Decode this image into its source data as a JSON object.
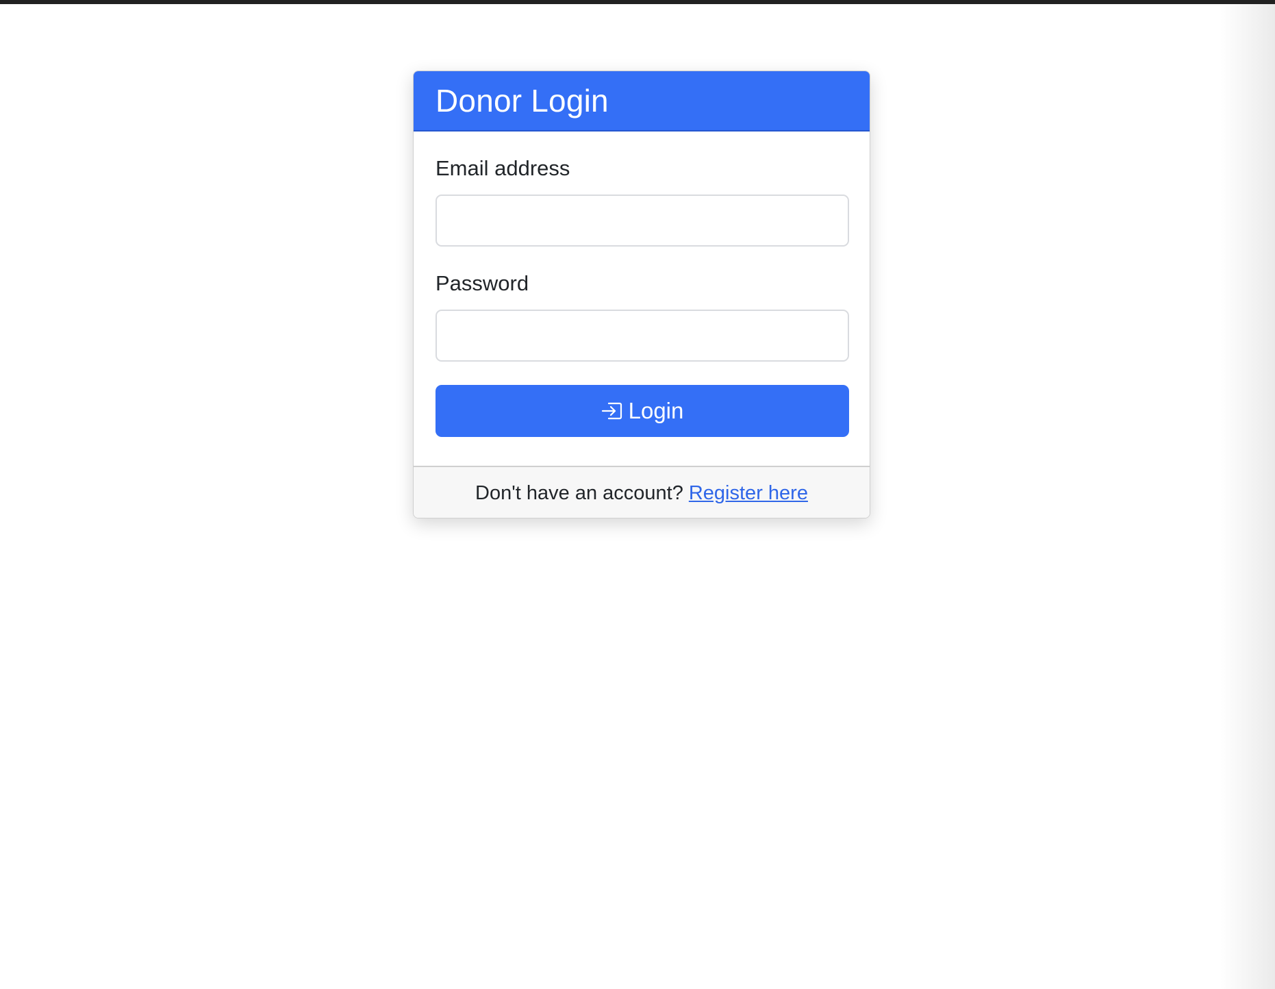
{
  "page": {
    "colors": {
      "primary": "#346ff6",
      "link": "#2f66e8",
      "top_bar": "#212121",
      "footer_bg": "#f7f7f7"
    }
  },
  "card": {
    "title": "Donor Login",
    "email": {
      "label": "Email address",
      "value": "",
      "placeholder": ""
    },
    "password": {
      "label": "Password",
      "value": "",
      "placeholder": ""
    },
    "login_button": {
      "icon": "box-arrow-in-right-icon",
      "label": "Login"
    },
    "footer": {
      "text": "Don't have an account?",
      "link_label": "Register here"
    }
  }
}
